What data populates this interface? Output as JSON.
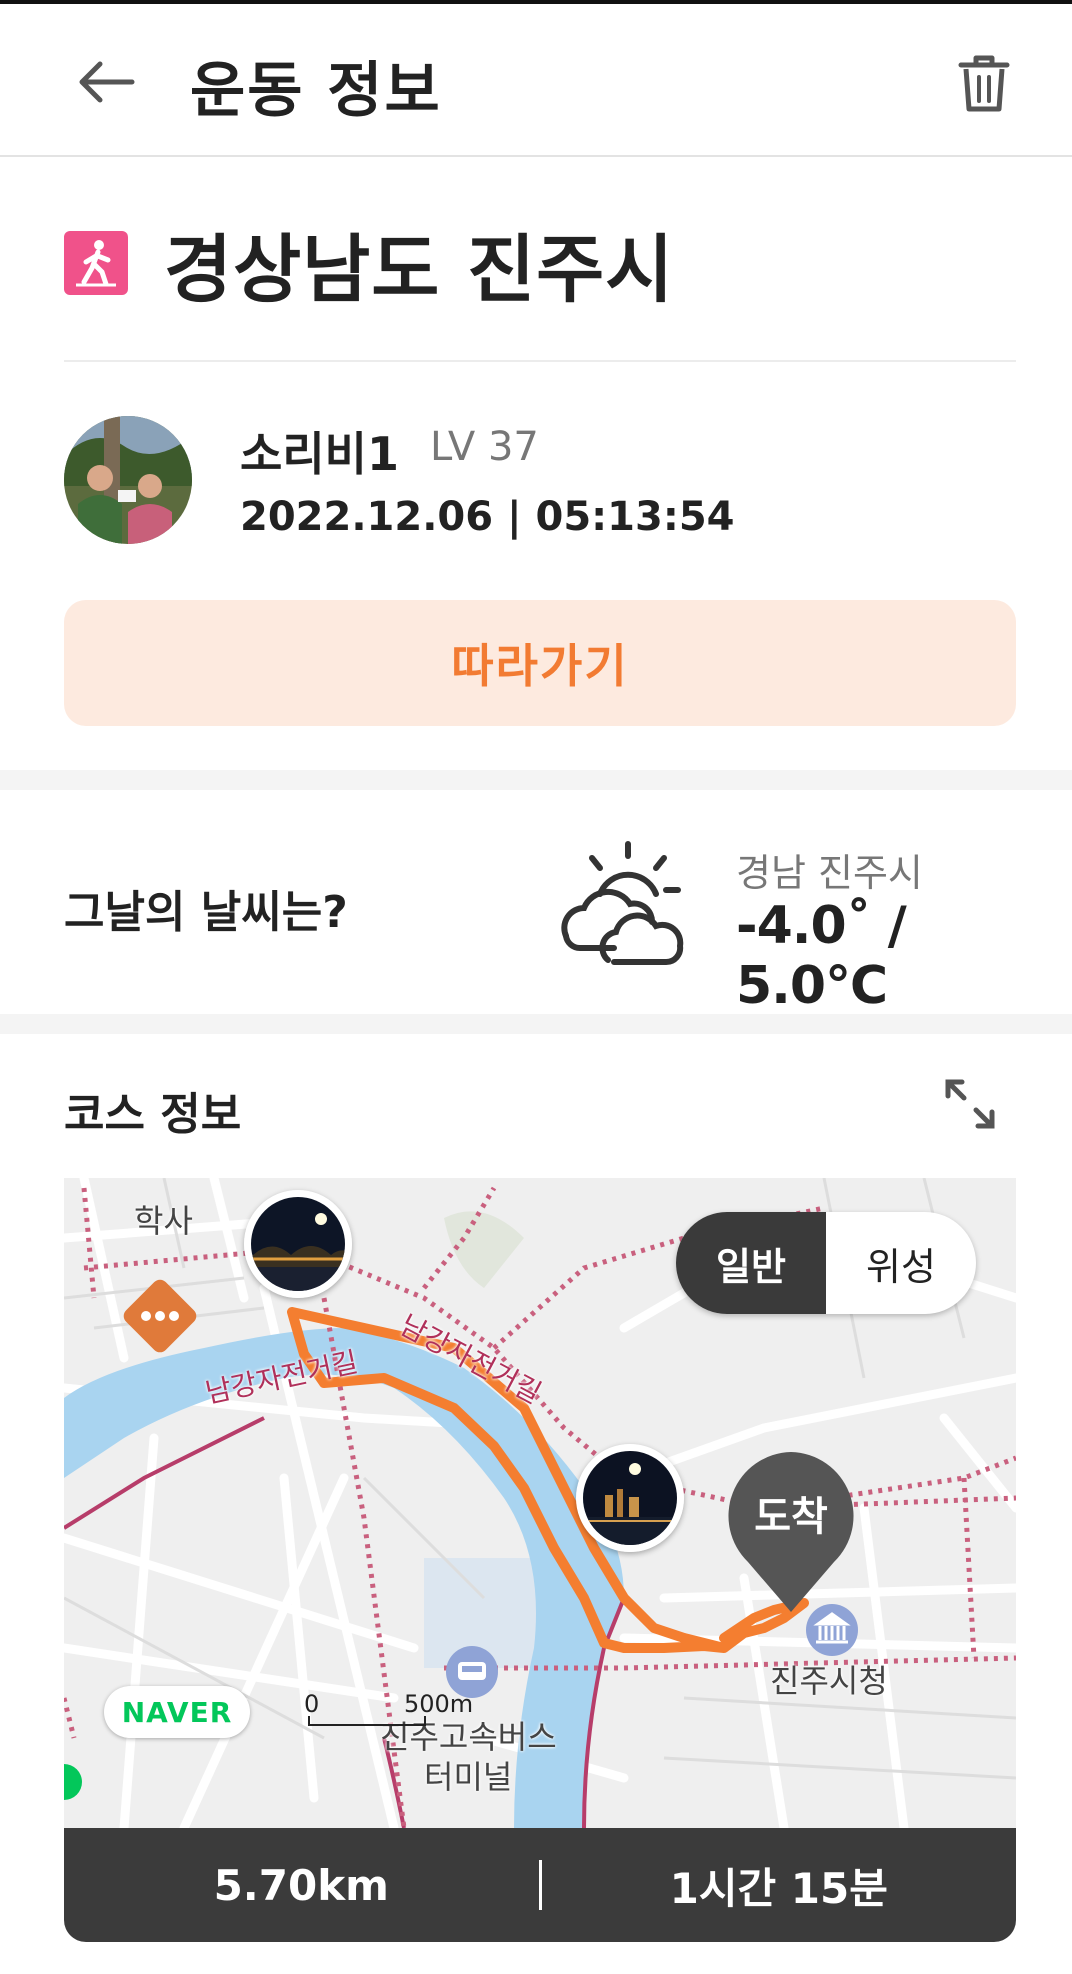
{
  "header": {
    "title": "운동 정보",
    "back_icon": "arrow-left-icon",
    "delete_icon": "trash-icon"
  },
  "activity": {
    "type_icon": "walking-icon",
    "location": "경상남도 진주시"
  },
  "user": {
    "name": "소리비1",
    "level": "LV 37",
    "datetime": "2022.12.06 | 05:13:54"
  },
  "follow_button": {
    "label": "따라가기"
  },
  "weather": {
    "question": "그날의 날씨는?",
    "icon": "partly-cloudy-icon",
    "location": "경남 진주시",
    "temperature": "-4.0˚ / 5.0℃"
  },
  "course": {
    "title": "코스 정보",
    "expand_icon": "expand-icon",
    "map": {
      "toggle": {
        "normal": "일반",
        "satellite": "위성",
        "selected": "일반"
      },
      "labels": {
        "academy_top": "학사",
        "city_hall": "진주시청",
        "bus_terminal_line1": "진주고속버스",
        "bus_terminal_line2": "터미널",
        "road_1": "남강자전거길",
        "road_2": "남강자전거길"
      },
      "arrival_label": "도착",
      "logo": "NAVER",
      "scale": {
        "zero": "0",
        "distance": "500m"
      }
    },
    "summary": {
      "distance": "5.70km",
      "duration": "1시간 15분"
    }
  },
  "colors": {
    "accent": "#f27b32",
    "accent_bg": "#fdeadf",
    "route": "#f47e30",
    "river": "#a9d4f0",
    "walk_icon_bg": "#f0528a",
    "summary_bg": "#3b3b3b"
  }
}
